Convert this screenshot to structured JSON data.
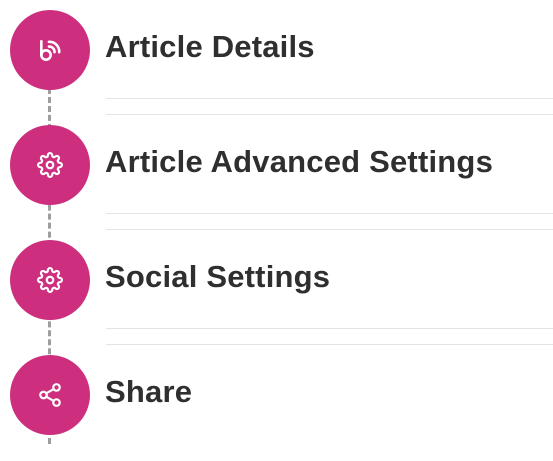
{
  "accent_color": "#cd2f7e",
  "steps": [
    {
      "title": "Article Details",
      "icon": "blog-rss-icon"
    },
    {
      "title": "Article Advanced Settings",
      "icon": "gear-icon"
    },
    {
      "title": "Social Settings",
      "icon": "gear-icon"
    },
    {
      "title": "Share",
      "icon": "share-icon"
    }
  ]
}
